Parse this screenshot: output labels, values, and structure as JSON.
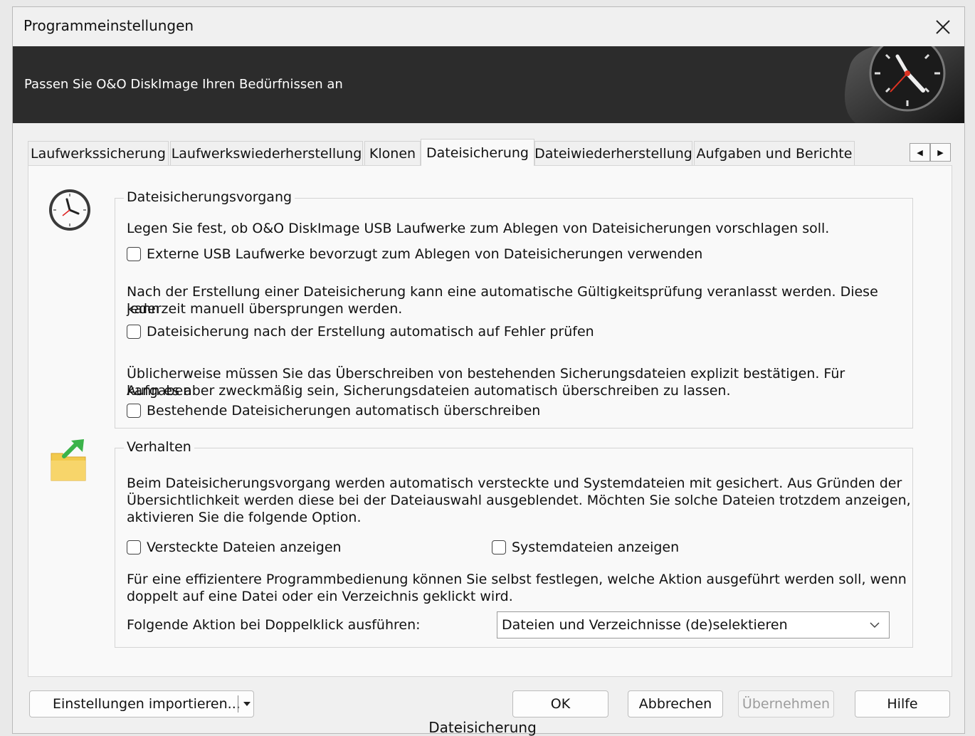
{
  "window": {
    "title": "Programmeinstellungen"
  },
  "banner": {
    "text": "Passen Sie O&O DiskImage Ihren Bedürfnissen an"
  },
  "tabs": [
    {
      "label": "Laufwerkssicherung"
    },
    {
      "label": "Laufwerkswiederherstellung"
    },
    {
      "label": "Klonen"
    },
    {
      "label": "Dateisicherung",
      "active": true
    },
    {
      "label": "Dateiwiederherstellung"
    },
    {
      "label": "Aufgaben und Berichte"
    }
  ],
  "group1": {
    "title": "Dateisicherungsvorgang",
    "text1": "Legen Sie fest, ob O&O DiskImage USB Laufwerke zum Ablegen von Dateisicherungen vorschlagen soll.",
    "check1": "Externe USB Laufwerke bevorzugt zum Ablegen von Dateisicherungen verwenden",
    "text2a": "Nach der Erstellung einer Dateisicherung kann eine automatische Gültigkeitsprüfung veranlasst werden. Diese kann",
    "text2b": "jederzeit manuell übersprungen werden.",
    "check2": "Dateisicherung nach der Erstellung automatisch auf Fehler prüfen",
    "text3a": "Üblicherweise müssen Sie das Überschreiben von bestehenden Sicherungsdateien explizit bestätigen. Für Aufgaben",
    "text3b": "kann es aber zweckmäßig sein, Sicherungsdateien automatisch überschreiben zu lassen.",
    "check3": "Bestehende Dateisicherungen automatisch überschreiben"
  },
  "group2": {
    "title": "Verhalten",
    "text1a": "Beim Dateisicherungsvorgang werden automatisch versteckte und Systemdateien mit gesichert. Aus Gründen der",
    "text1b": "Übersichtlichkeit werden diese bei der Dateiauswahl ausgeblendet. Möchten Sie solche Dateien trotzdem anzeigen,",
    "text1c": "aktivieren Sie die folgende Option.",
    "check_hidden": "Versteckte Dateien anzeigen",
    "check_system": "Systemdateien anzeigen",
    "text2a": "Für eine effizientere Programmbedienung können Sie selbst festlegen, welche Aktion ausgeführt werden soll, wenn",
    "text2b": "doppelt auf eine Datei oder ein Verzeichnis geklickt wird.",
    "action_label": "Folgende Aktion bei Doppelklick ausführen:",
    "action_value": "Dateien und Verzeichnisse (de)selektieren"
  },
  "buttons": {
    "import": "Einstellungen importieren...",
    "ok": "OK",
    "cancel": "Abbrechen",
    "apply": "Übernehmen",
    "help": "Hilfe"
  },
  "caption": "Dateisicherung"
}
